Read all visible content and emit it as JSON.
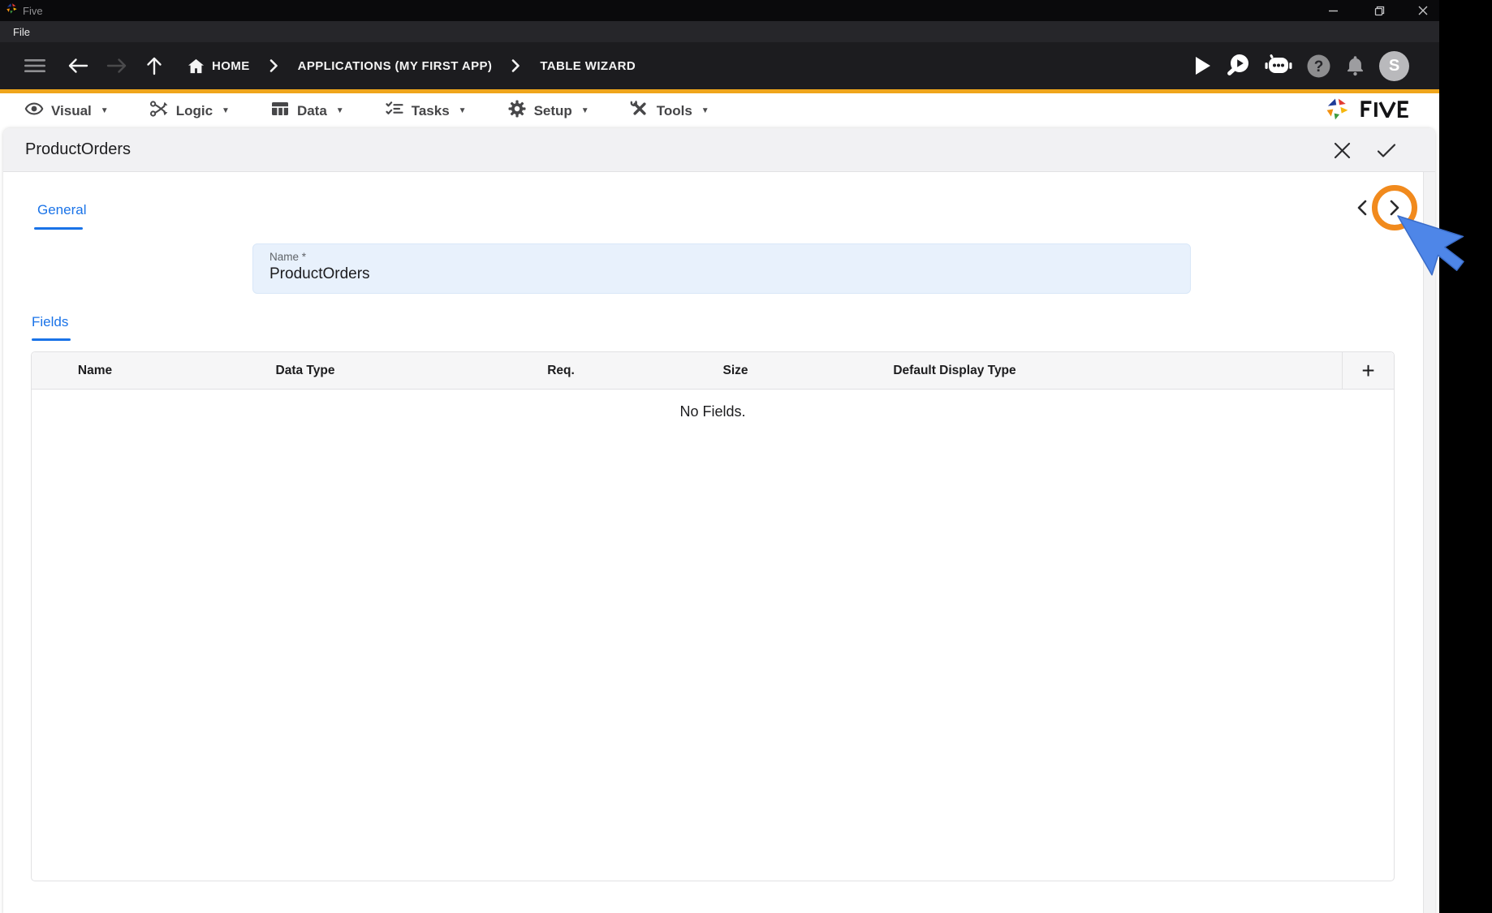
{
  "window": {
    "title": "Five",
    "user_initial": "S"
  },
  "menus": {
    "file": "File"
  },
  "toolbar": {
    "breadcrumbs": [
      {
        "label": "HOME"
      },
      {
        "label": "APPLICATIONS (MY FIRST APP)"
      },
      {
        "label": "TABLE WIZARD"
      }
    ]
  },
  "ribbon": {
    "items": [
      {
        "label": "Visual"
      },
      {
        "label": "Logic"
      },
      {
        "label": "Data"
      },
      {
        "label": "Tasks"
      },
      {
        "label": "Setup"
      },
      {
        "label": "Tools"
      }
    ],
    "brand": "FIVE"
  },
  "form": {
    "title": "ProductOrders",
    "tabs": {
      "general": "General",
      "fields": "Fields"
    },
    "name_field": {
      "label": "Name *",
      "value": "ProductOrders"
    },
    "fields_table": {
      "columns": [
        "Name",
        "Data Type",
        "Req.",
        "Size",
        "Default Display Type"
      ],
      "empty_message": "No Fields.",
      "add_label": "+"
    }
  },
  "colors": {
    "accent_yellow": "#EFA51B",
    "tab_blue": "#1A73E8",
    "field_bg": "#E8F1FC",
    "ring_orange": "#F18A1D",
    "cursor_blue": "#4E86E8"
  }
}
